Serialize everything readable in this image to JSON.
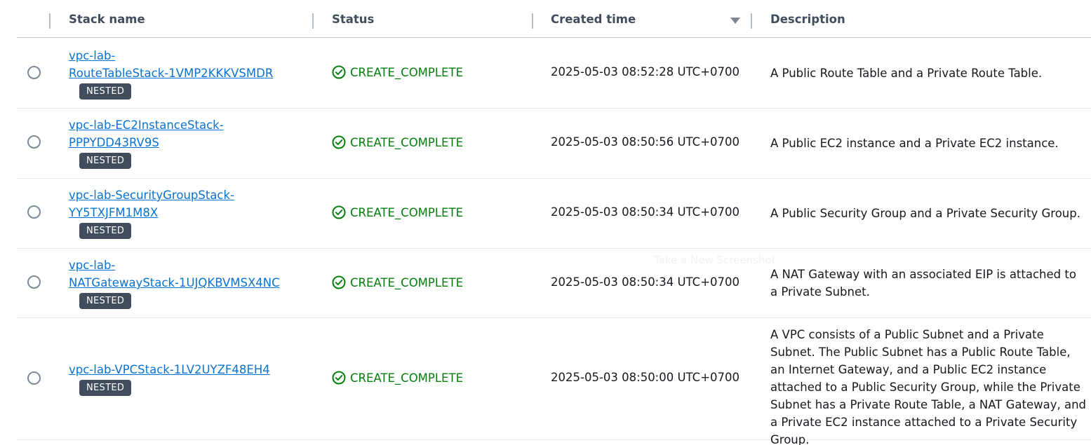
{
  "table": {
    "columns": {
      "stack_name": "Stack name",
      "status": "Status",
      "created_time": "Created time",
      "description": "Description"
    },
    "sort_icon": "caret-down-icon",
    "rows": [
      {
        "name_line1": "vpc-lab-",
        "name_line2": "RouteTableStack-1VMP2KKKVSMDR",
        "badge": "NESTED",
        "status": "CREATE_COMPLETE",
        "created_time": "2025-05-03 08:52:28 UTC+0700",
        "description": "A Public Route Table and a Private Route Table."
      },
      {
        "name_line1": "vpc-lab-EC2InstanceStack-",
        "name_line2": "PPPYDD43RV9S",
        "badge": "NESTED",
        "status": "CREATE_COMPLETE",
        "created_time": "2025-05-03 08:50:56 UTC+0700",
        "description": "A Public EC2 instance and a Private EC2 instance."
      },
      {
        "name_line1": "vpc-lab-SecurityGroupStack-",
        "name_line2": "YY5TXJFM1M8X",
        "badge": "NESTED",
        "status": "CREATE_COMPLETE",
        "created_time": "2025-05-03 08:50:34 UTC+0700",
        "description": "A Public Security Group and a Private Security Group."
      },
      {
        "name_line1": "vpc-lab-",
        "name_line2": "NATGatewayStack-1UJQKBVMSX4NC",
        "badge": "NESTED",
        "status": "CREATE_COMPLETE",
        "created_time": "2025-05-03 08:50:34 UTC+0700",
        "description": "A NAT Gateway with an associated EIP is attached to a Private Subnet."
      },
      {
        "name_line1": "vpc-lab-VPCStack-1LV2UYZF48EH4",
        "badge": "NESTED",
        "status": "CREATE_COMPLETE",
        "created_time": "2025-05-03 08:50:00 UTC+0700",
        "description": "A VPC consists of a Public Subnet and a Private Subnet. The Public Subnet has a Public Route Table, an Internet Gateway, and a Public EC2 instance attached to a Public Security Group, while the Private Subnet has a Private Route Table, a NAT Gateway, and a Private EC2 instance attached to a Private Security Group."
      }
    ]
  },
  "overlay": {
    "ghost_text": "Take a New Screenshot"
  },
  "colors": {
    "link": "#0972d3",
    "success": "#037f0c",
    "badge_bg": "#414d5c"
  }
}
